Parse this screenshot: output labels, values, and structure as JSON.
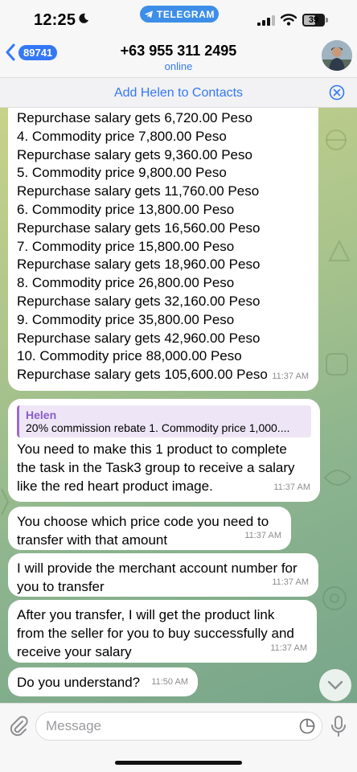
{
  "status_bar": {
    "time": "12:25",
    "app_pill": "TELEGRAM",
    "battery": "39"
  },
  "header": {
    "back_count": "89741",
    "title": "+63 955 311 2495",
    "subtitle": "online"
  },
  "add_contact_label": "Add Helen to Contacts",
  "messages": [
    {
      "text": "Repurchase salary gets 6,720.00 Peso\n4. Commodity price 7,800.00 Peso\nRepurchase salary gets 9,360.00 Peso\n5. Commodity price 9,800.00 Peso\nRepurchase salary gets 11,760.00 Peso\n6. Commodity price 13,800.00 Peso\nRepurchase salary gets 16,560.00 Peso\n7. Commodity price 15,800.00 Peso\nRepurchase salary gets 18,960.00 Peso\n8. Commodity price 26,800.00 Peso\nRepurchase salary gets 32,160.00 Peso\n9. Commodity price 35,800.00 Peso\nRepurchase salary gets 42,960.00 Peso\n10. Commodity price 88,000.00 Peso\nRepurchase salary gets 105,600.00 Peso",
      "time": "11:37 AM"
    },
    {
      "reply_name": "Helen",
      "reply_text": "20% commission rebate 1. Commodity price 1,000....",
      "text": "You need to make this 1 product to complete\nthe task in the Task3 group to receive a salary\nlike the red heart product image.",
      "time": "11:37 AM"
    },
    {
      "text": "You choose which price code you need to\ntransfer with that amount",
      "time": "11:37 AM"
    },
    {
      "text": "I will provide the merchant account number for\nyou to transfer",
      "time": "11:37 AM"
    },
    {
      "text": "After you transfer, I will get the product link\nfrom the seller for you to buy successfully and\nreceive your salary",
      "time": "11:37 AM"
    },
    {
      "text": "Do you understand?",
      "time": "11:50 AM"
    }
  ],
  "input": {
    "placeholder": "Message"
  },
  "colors": {
    "accent": "#3478f6",
    "telegram_pill": "#3d8ee8",
    "reply_accent": "#9a6ad0"
  }
}
